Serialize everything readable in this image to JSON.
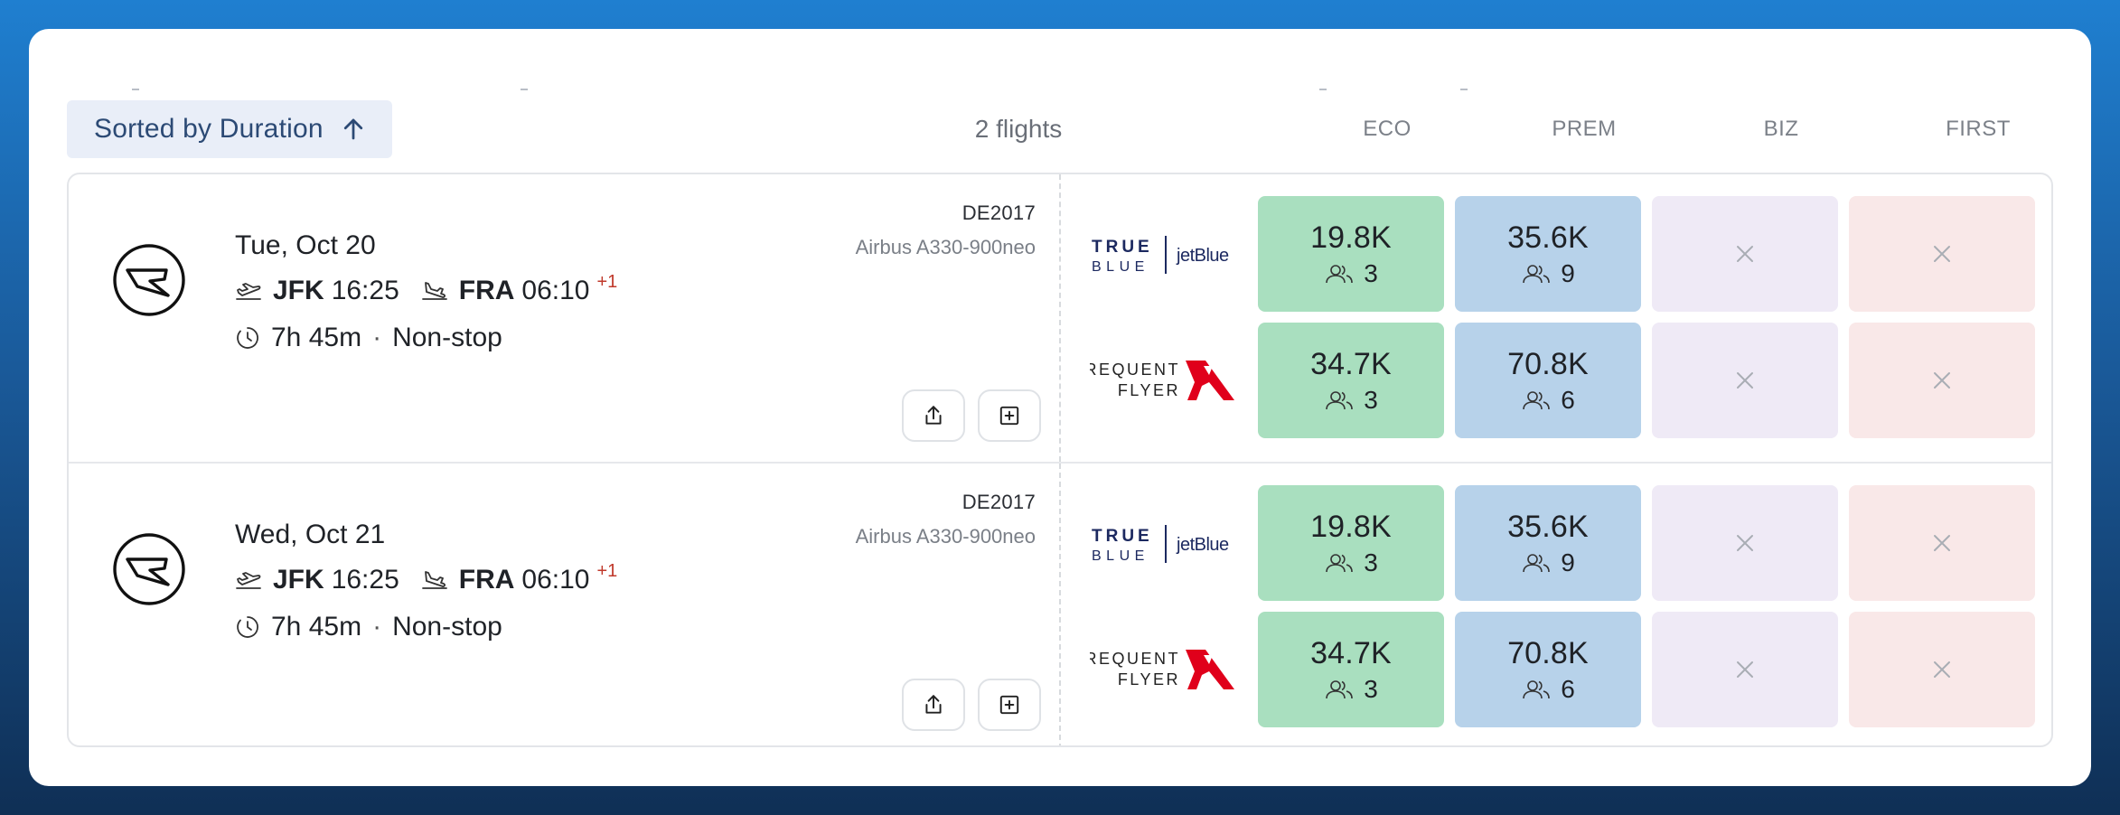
{
  "header": {
    "sort_label": "Sorted by Duration",
    "flights_count": "2 flights",
    "columns": [
      "ECO",
      "PREM",
      "BIZ",
      "FIRST"
    ]
  },
  "colors": {
    "eco": "#a9dfbf",
    "prem": "#b7d2ea",
    "biz": "#efeaf6",
    "first": "#f9e8e8",
    "accent": "#2c4a75",
    "day_offset": "#c0392b"
  },
  "flights": [
    {
      "date": "Tue, Oct 20",
      "origin": "JFK",
      "depart": "16:25",
      "destination": "FRA",
      "arrive": "06:10",
      "day_offset": "+1",
      "duration": "7h 45m",
      "stops": "Non-stop",
      "flight_number": "DE2017",
      "aircraft": "Airbus A330-900neo",
      "airline_icon": "condor-logo-icon",
      "programs": [
        {
          "name": "TrueBlue",
          "logo_lines": [
            "TRUE",
            "BLUE",
            "jetBlue"
          ],
          "eco": {
            "points": "19.8K",
            "seats": "3"
          },
          "prem": {
            "points": "35.6K",
            "seats": "9"
          },
          "biz": null,
          "first": null
        },
        {
          "name": "Frequent Flyer",
          "logo_lines": [
            "FREQUENT",
            "FLYER"
          ],
          "eco": {
            "points": "34.7K",
            "seats": "3"
          },
          "prem": {
            "points": "70.8K",
            "seats": "6"
          },
          "biz": null,
          "first": null
        }
      ]
    },
    {
      "date": "Wed, Oct 21",
      "origin": "JFK",
      "depart": "16:25",
      "destination": "FRA",
      "arrive": "06:10",
      "day_offset": "+1",
      "duration": "7h 45m",
      "stops": "Non-stop",
      "flight_number": "DE2017",
      "aircraft": "Airbus A330-900neo",
      "airline_icon": "condor-logo-icon",
      "programs": [
        {
          "name": "TrueBlue",
          "logo_lines": [
            "TRUE",
            "BLUE",
            "jetBlue"
          ],
          "eco": {
            "points": "19.8K",
            "seats": "3"
          },
          "prem": {
            "points": "35.6K",
            "seats": "9"
          },
          "biz": null,
          "first": null
        },
        {
          "name": "Frequent Flyer",
          "logo_lines": [
            "FREQUENT",
            "FLYER"
          ],
          "eco": {
            "points": "34.7K",
            "seats": "3"
          },
          "prem": {
            "points": "70.8K",
            "seats": "6"
          },
          "biz": null,
          "first": null
        }
      ]
    }
  ]
}
